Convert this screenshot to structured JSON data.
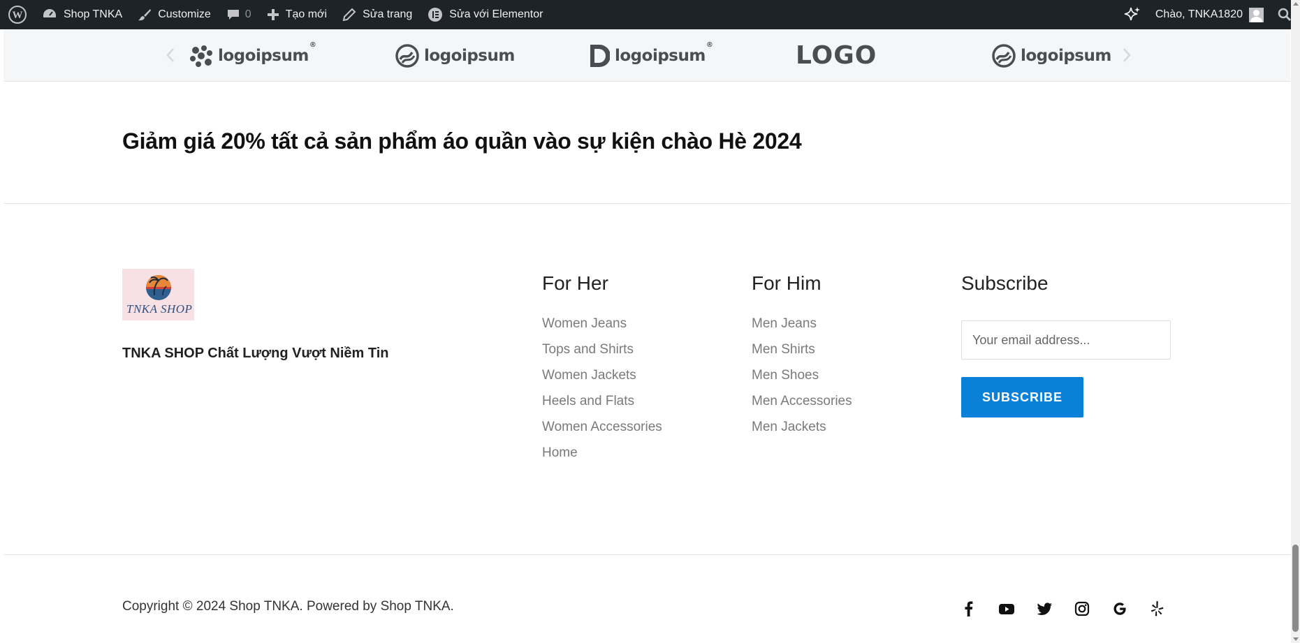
{
  "adminbar": {
    "site_name": "Shop TNKA",
    "customize": "Customize",
    "comments_count": "0",
    "new": "Tạo mới",
    "edit_page": "Sửa trang",
    "edit_elementor": "Sửa với Elementor",
    "greeting": "Chào, TNKA1820"
  },
  "logos": [
    {
      "icon": "dots-logo-icon",
      "text": "logoipsum",
      "sup": "®"
    },
    {
      "icon": "swirl-circle-logo-icon",
      "text": "logoipsum"
    },
    {
      "icon": "half-circle-logo-icon",
      "text": "logoipsum",
      "sup": "®"
    },
    {
      "icon": "logo-wordmark",
      "text": "LOGO"
    },
    {
      "icon": "swirl-circle-logo-icon",
      "text": "logoipsum"
    }
  ],
  "promo": {
    "headline": "Giảm giá 20% tất cả sản phẩm áo quần vào sự kiện chào Hè 2024"
  },
  "footer": {
    "brand_logo_text": "TNKA SHOP",
    "tagline": "TNKA SHOP Chất Lượng Vượt Niềm Tin",
    "for_her": {
      "title": "For Her",
      "items": [
        "Women Jeans",
        "Tops and Shirts",
        "Women Jackets",
        "Heels and Flats",
        "Women Accessories",
        "Home"
      ]
    },
    "for_him": {
      "title": "For Him",
      "items": [
        "Men Jeans",
        "Men Shirts",
        "Men Shoes",
        "Men Accessories",
        "Men Jackets"
      ]
    },
    "subscribe": {
      "title": "Subscribe",
      "placeholder": "Your email address...",
      "button": "SUBSCRIBE"
    }
  },
  "bottom": {
    "copyright": "Copyright © 2024 Shop TNKA. Powered by Shop TNKA.",
    "social": [
      "facebook-icon",
      "youtube-icon",
      "twitter-icon",
      "instagram-icon",
      "google-icon",
      "yelp-icon"
    ]
  },
  "colors": {
    "admin_bar": "#1d2327",
    "accent_blue": "#0a80d8",
    "link_gray": "#7a7a7a"
  }
}
